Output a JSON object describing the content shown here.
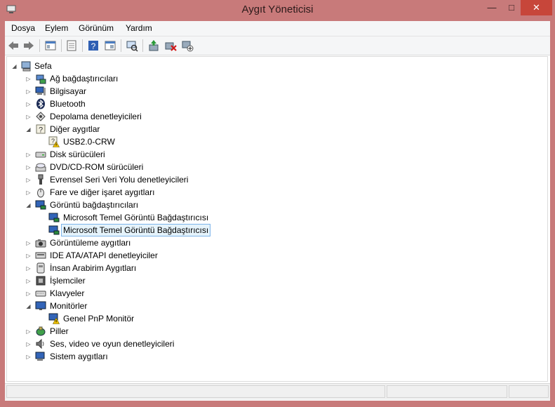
{
  "window": {
    "title": "Aygıt Yöneticisi",
    "minimize": "—",
    "maximize": "□",
    "close": "✕"
  },
  "menu": [
    {
      "label": "Dosya"
    },
    {
      "label": "Eylem"
    },
    {
      "label": "Görünüm"
    },
    {
      "label": "Yardım"
    }
  ],
  "toolbar": {
    "buttons": [
      "back-icon",
      "forward-icon",
      "console-tree-icon",
      "properties-icon",
      "help-icon",
      "view-icon",
      "scan-hardware-icon",
      "update-driver-icon",
      "uninstall-icon",
      "disable-icon"
    ]
  },
  "tree": {
    "root": "Sefa",
    "items": [
      {
        "label": "Ağ bağdaştırıcıları",
        "icon": "network-adapter-icon",
        "expanded": false
      },
      {
        "label": "Bilgisayar",
        "icon": "computer-icon",
        "expanded": false
      },
      {
        "label": "Bluetooth",
        "icon": "bluetooth-icon",
        "expanded": false
      },
      {
        "label": "Depolama denetleyicileri",
        "icon": "storage-controller-icon",
        "expanded": false
      },
      {
        "label": "Diğer aygıtlar",
        "icon": "other-devices-icon",
        "expanded": true
      },
      {
        "label": "USB2.0-CRW",
        "icon": "unknown-device-warning-icon",
        "child": true
      },
      {
        "label": "Disk sürücüleri",
        "icon": "disk-drive-icon",
        "expanded": false
      },
      {
        "label": "DVD/CD-ROM sürücüleri",
        "icon": "dvd-drive-icon",
        "expanded": false
      },
      {
        "label": "Evrensel Seri Veri Yolu denetleyicileri",
        "icon": "usb-icon",
        "expanded": false
      },
      {
        "label": "Fare ve diğer işaret aygıtları",
        "icon": "mouse-icon",
        "expanded": false
      },
      {
        "label": "Görüntü bağdaştırıcıları",
        "icon": "display-adapter-icon",
        "expanded": true
      },
      {
        "label": "Microsoft Temel Görüntü Bağdaştırıcısı",
        "icon": "display-adapter-icon",
        "child": true
      },
      {
        "label": "Microsoft Temel Görüntü Bağdaştırıcısı",
        "icon": "display-adapter-icon",
        "child": true,
        "selected": true
      },
      {
        "label": "Görüntüleme aygıtları",
        "icon": "imaging-device-icon",
        "expanded": false
      },
      {
        "label": "IDE ATA/ATAPI denetleyiciler",
        "icon": "ide-controller-icon",
        "expanded": false
      },
      {
        "label": "İnsan Arabirim Aygıtları",
        "icon": "hid-icon",
        "expanded": false
      },
      {
        "label": "İşlemciler",
        "icon": "processor-icon",
        "expanded": false
      },
      {
        "label": "Klavyeler",
        "icon": "keyboard-icon",
        "expanded": false
      },
      {
        "label": "Monitörler",
        "icon": "monitor-icon",
        "expanded": true
      },
      {
        "label": "Genel PnP Monitör",
        "icon": "monitor-warning-icon",
        "child": true
      },
      {
        "label": "Piller",
        "icon": "battery-icon",
        "expanded": false
      },
      {
        "label": "Ses, video ve oyun denetleyicileri",
        "icon": "sound-icon",
        "expanded": false
      },
      {
        "label": "Sistem aygıtları",
        "icon": "system-devices-icon",
        "expanded": false
      }
    ]
  },
  "colors": {
    "titlebar": "#c87a7a",
    "close": "#c7463a",
    "selection": "#e5f3fb",
    "selection_border": "#7eb4ea"
  }
}
